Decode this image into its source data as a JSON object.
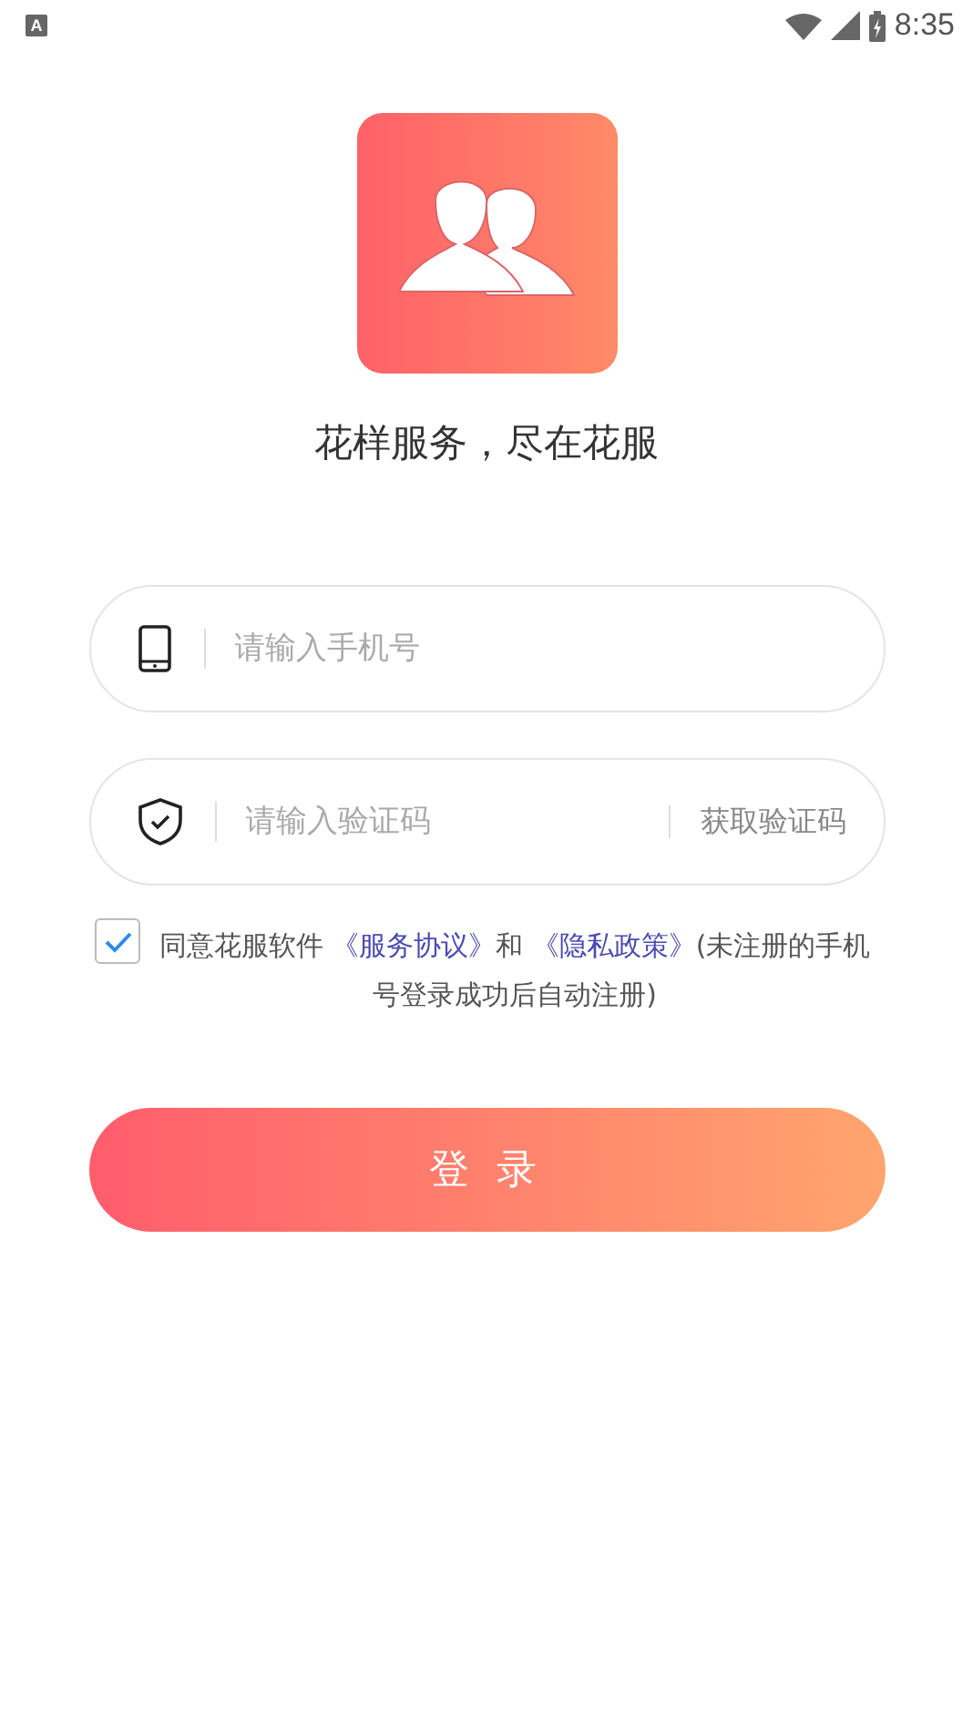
{
  "status_bar": {
    "notification": "A",
    "time": "8:35"
  },
  "slogan": "花样服务，尽在花服",
  "phone_field": {
    "placeholder": "请输入手机号"
  },
  "code_field": {
    "placeholder": "请输入验证码",
    "action": "获取验证码"
  },
  "agreement": {
    "checked": true,
    "parts": [
      {
        "kind": "text",
        "text": "同意花服软件 "
      },
      {
        "kind": "link",
        "text": "《服务协议》"
      },
      {
        "kind": "text",
        "text": "和 "
      },
      {
        "kind": "link",
        "text": "《隐私政策》"
      },
      {
        "kind": "text",
        "text": "(未注册的手机号登录成功后自动注册)"
      }
    ]
  },
  "login_button": "登 录"
}
